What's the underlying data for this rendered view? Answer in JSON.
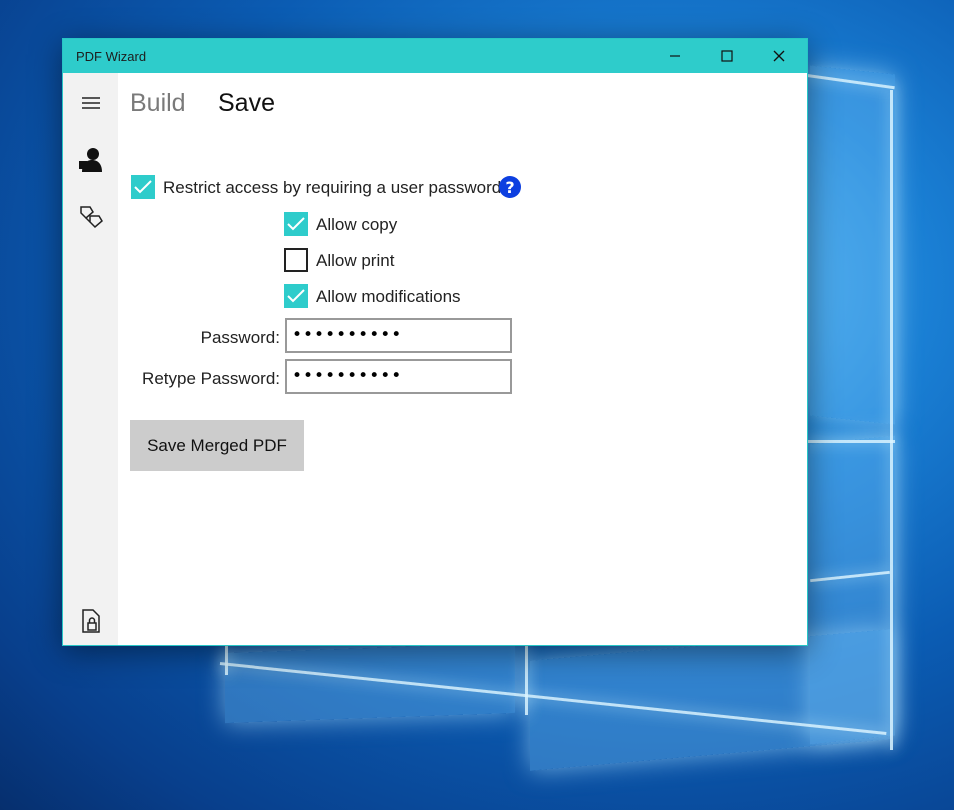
{
  "window": {
    "title": "PDF Wizard",
    "accent_color": "#2ecccb",
    "controls": [
      "minimize-icon",
      "maximize-icon",
      "close-icon"
    ]
  },
  "sidebar": {
    "items": [
      {
        "icon": "hamburger-menu-icon"
      },
      {
        "icon": "person-icon",
        "selected": true
      },
      {
        "icon": "merge-pages-icon"
      },
      {
        "icon": "locked-document-icon"
      }
    ]
  },
  "tabs": [
    {
      "label": "Build",
      "active": false
    },
    {
      "label": "Save",
      "active": true
    }
  ],
  "options": {
    "restrict": {
      "label": "Restrict access by requiring a user password",
      "checked": true,
      "help_glyph": "?"
    },
    "allow_copy": {
      "label": "Allow copy",
      "checked": true
    },
    "allow_print": {
      "label": "Allow print",
      "checked": false
    },
    "allow_modifications": {
      "label": "Allow modifications",
      "checked": true
    }
  },
  "password": {
    "label": "Password:",
    "value": "••••••••••"
  },
  "retype_password": {
    "label": "Retype Password:",
    "value": "••••••••••"
  },
  "save_button": {
    "label": "Save Merged PDF"
  }
}
